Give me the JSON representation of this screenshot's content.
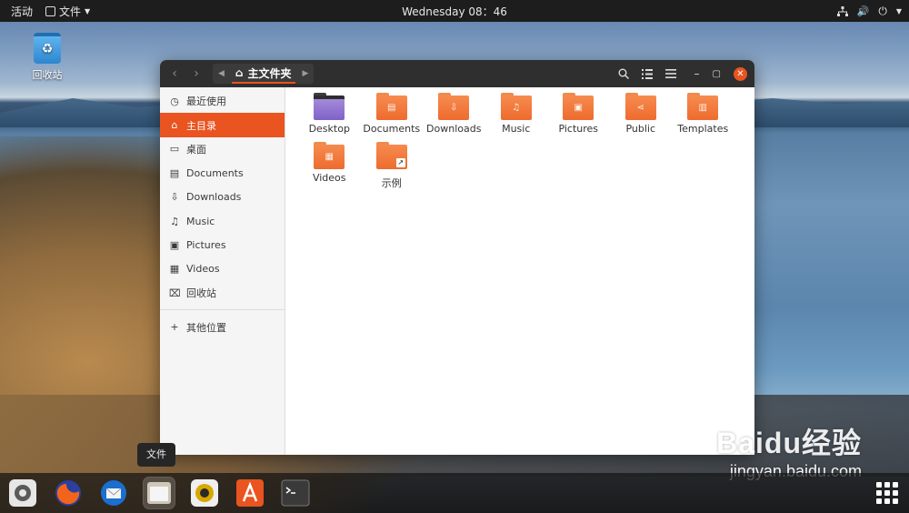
{
  "topbar": {
    "activities": "活动",
    "app_menu": "文件",
    "clock": "Wednesday 08：46"
  },
  "desktop": {
    "trash_label": "回收站"
  },
  "window": {
    "path": "主文件夹",
    "sidebar": [
      {
        "label": "最近使用",
        "icon": "clock-icon",
        "glyph": "◷"
      },
      {
        "label": "主目录",
        "icon": "home-icon",
        "glyph": "⌂",
        "active": true
      },
      {
        "label": "桌面",
        "icon": "desktop-icon",
        "glyph": "▭"
      },
      {
        "label": "Documents",
        "icon": "document-icon",
        "glyph": "▤"
      },
      {
        "label": "Downloads",
        "icon": "download-icon",
        "glyph": "⇩"
      },
      {
        "label": "Music",
        "icon": "music-icon",
        "glyph": "♫"
      },
      {
        "label": "Pictures",
        "icon": "picture-icon",
        "glyph": "▣"
      },
      {
        "label": "Videos",
        "icon": "video-icon",
        "glyph": "▦"
      },
      {
        "label": "回收站",
        "icon": "trash-icon",
        "glyph": "🗑"
      }
    ],
    "other_locations": "其他位置",
    "files": [
      {
        "name": "Desktop",
        "kind": "desktop",
        "glyph": ""
      },
      {
        "name": "Documents",
        "kind": "folder",
        "glyph": "▤"
      },
      {
        "name": "Downloads",
        "kind": "folder",
        "glyph": "⇩"
      },
      {
        "name": "Music",
        "kind": "folder",
        "glyph": "♫"
      },
      {
        "name": "Pictures",
        "kind": "folder",
        "glyph": "▣"
      },
      {
        "name": "Public",
        "kind": "folder",
        "glyph": "⋖"
      },
      {
        "name": "Templates",
        "kind": "folder",
        "glyph": "▥"
      },
      {
        "name": "Videos",
        "kind": "folder",
        "glyph": "▦"
      },
      {
        "name": "示例",
        "kind": "link",
        "glyph": ""
      }
    ]
  },
  "dock": {
    "tooltip": "文件",
    "items": [
      "settings",
      "firefox",
      "thunderbird",
      "files",
      "rhythmbox",
      "software",
      "terminal"
    ]
  },
  "watermark": {
    "big": "Baidu经验",
    "small": "jingyan.baidu.com"
  },
  "colors": {
    "accent": "#e95420",
    "headerbar": "#2f2f2f",
    "topbar": "#1d1d1d"
  }
}
